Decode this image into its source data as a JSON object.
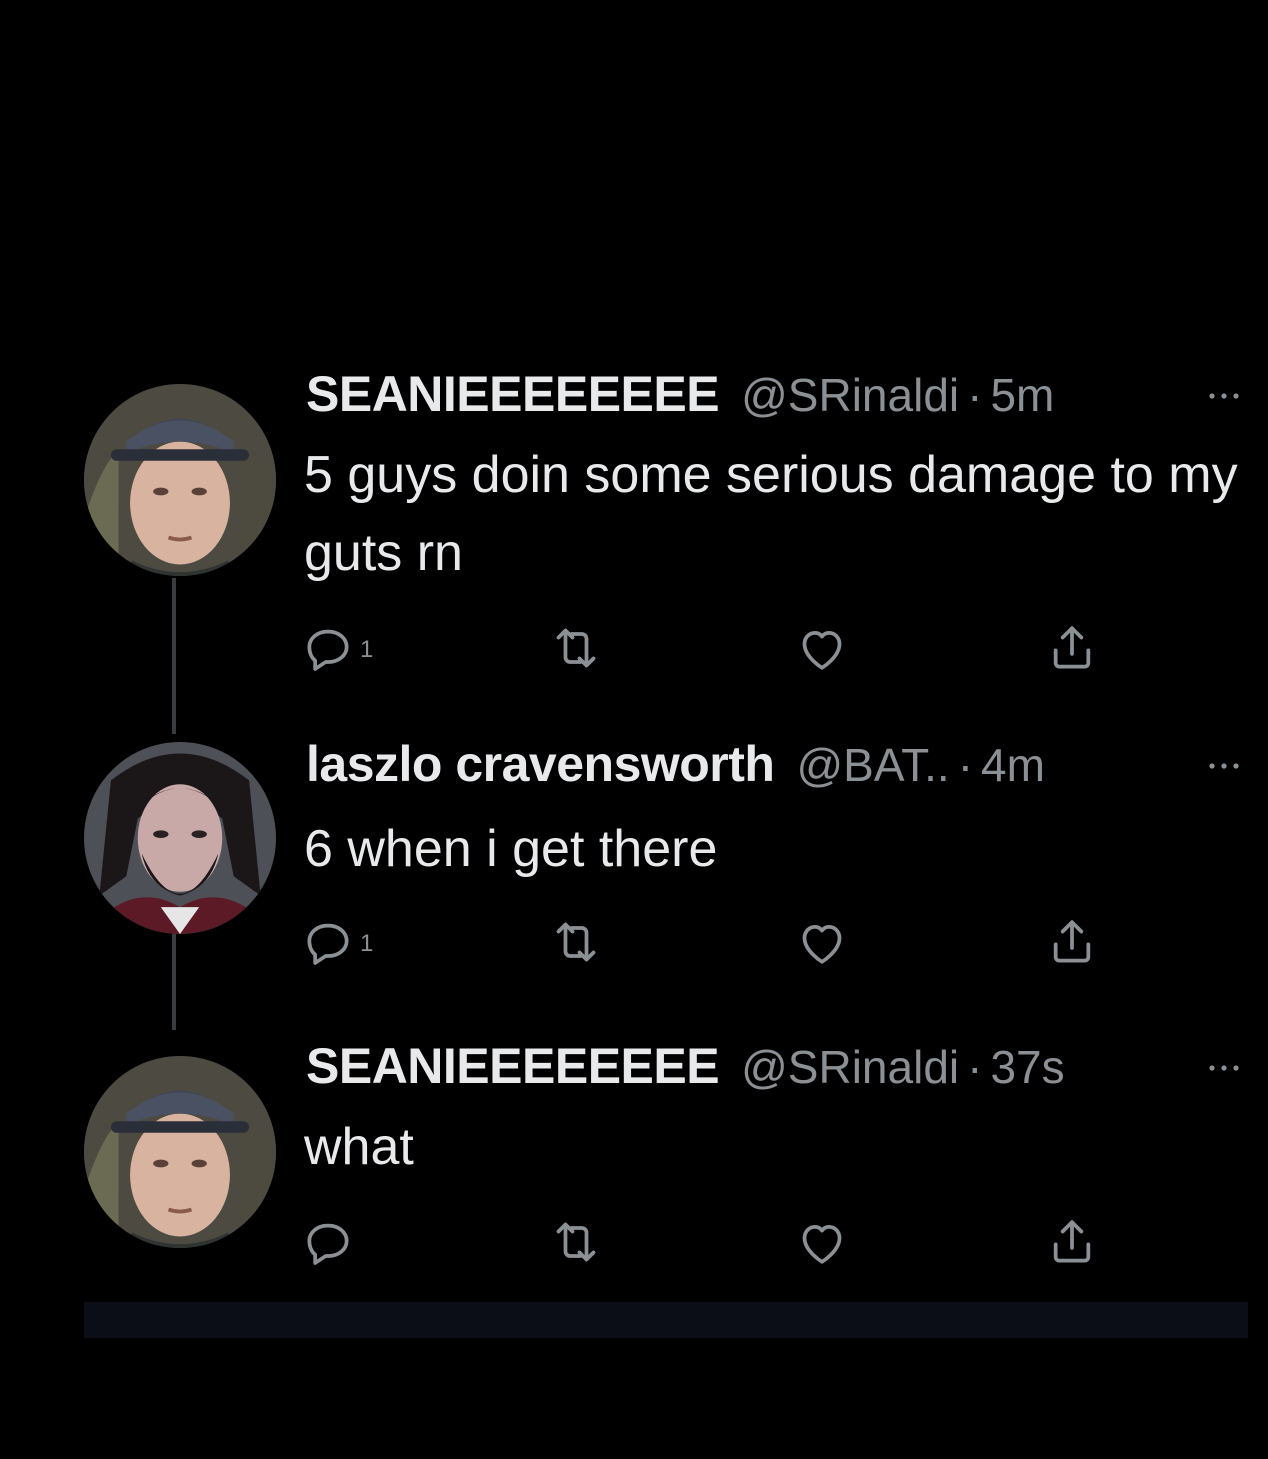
{
  "colors": {
    "background": "#000000",
    "primary_text": "#e7e9ea",
    "secondary_text": "#8b9095",
    "connector": "#3a3d40"
  },
  "tweets": [
    {
      "name": "SEANIEEEEEEEE",
      "handle": "@SRinaldi",
      "separator": "·",
      "time": "5m",
      "text": "5 guys doin some serious damage to my guts rn",
      "reply_count": "1",
      "avatar": "man-cap-avatar",
      "icons": [
        "reply-icon",
        "retweet-icon",
        "like-icon",
        "share-icon",
        "more-icon"
      ]
    },
    {
      "name": "laszlo cravensworth",
      "handle": "@BAT..",
      "separator": "·",
      "time": "4m",
      "text": "6 when i get there",
      "reply_count": "1",
      "avatar": "bearded-man-avatar",
      "icons": [
        "reply-icon",
        "retweet-icon",
        "like-icon",
        "share-icon",
        "more-icon"
      ]
    },
    {
      "name": "SEANIEEEEEEEE",
      "handle": "@SRinaldi",
      "separator": "·",
      "time": "37s",
      "text": "what",
      "reply_count": "",
      "avatar": "man-cap-avatar",
      "icons": [
        "reply-icon",
        "retweet-icon",
        "like-icon",
        "share-icon",
        "more-icon"
      ]
    }
  ]
}
